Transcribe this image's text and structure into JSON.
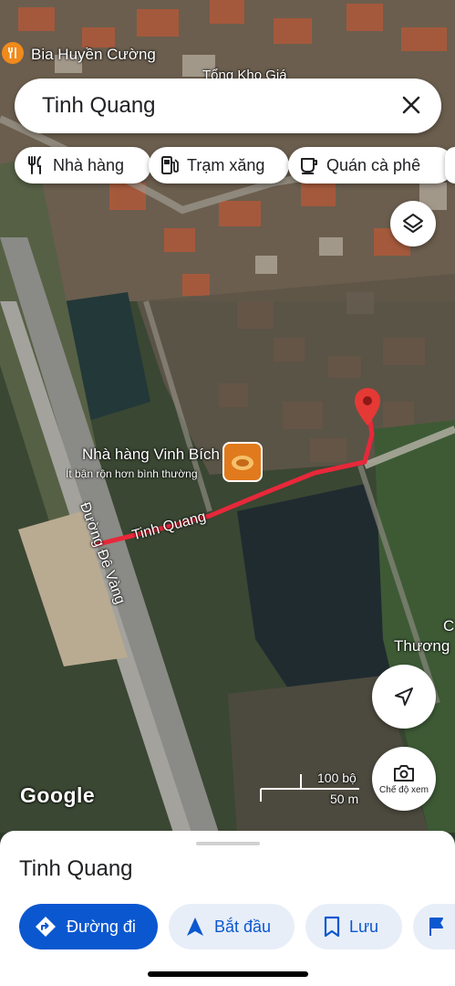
{
  "search": {
    "query": "Tinh Quang"
  },
  "chips": [
    {
      "icon": "fork-knife-icon",
      "label": "Nhà hàng"
    },
    {
      "icon": "gas-station-icon",
      "label": "Trạm xăng"
    },
    {
      "icon": "coffee-cup-icon",
      "label": "Quán cà phê"
    }
  ],
  "map_labels": {
    "top_place": "Bia Huyền Cường",
    "top_place2": "Tổng Kho Giá",
    "restaurant": "Nhà hàng Vinh Bích",
    "restaurant_sub": "Ít bận rộn hơn bình thường",
    "road1": "Đường Đê Vàng",
    "road2": "Tinh Quang",
    "right_place": "Thương",
    "right_place_c": "C",
    "brand": "Google",
    "scale_ft": "100 bộ",
    "scale_m": "50 m",
    "camera_label": "Chế độ xem"
  },
  "sheet": {
    "title": "Tinh Quang",
    "directions": "Đường đi",
    "start": "Bắt đầu",
    "save": "Lưu"
  },
  "colors": {
    "accent": "#0b57d0",
    "route": "#e8283a",
    "pin": "#e53935"
  }
}
